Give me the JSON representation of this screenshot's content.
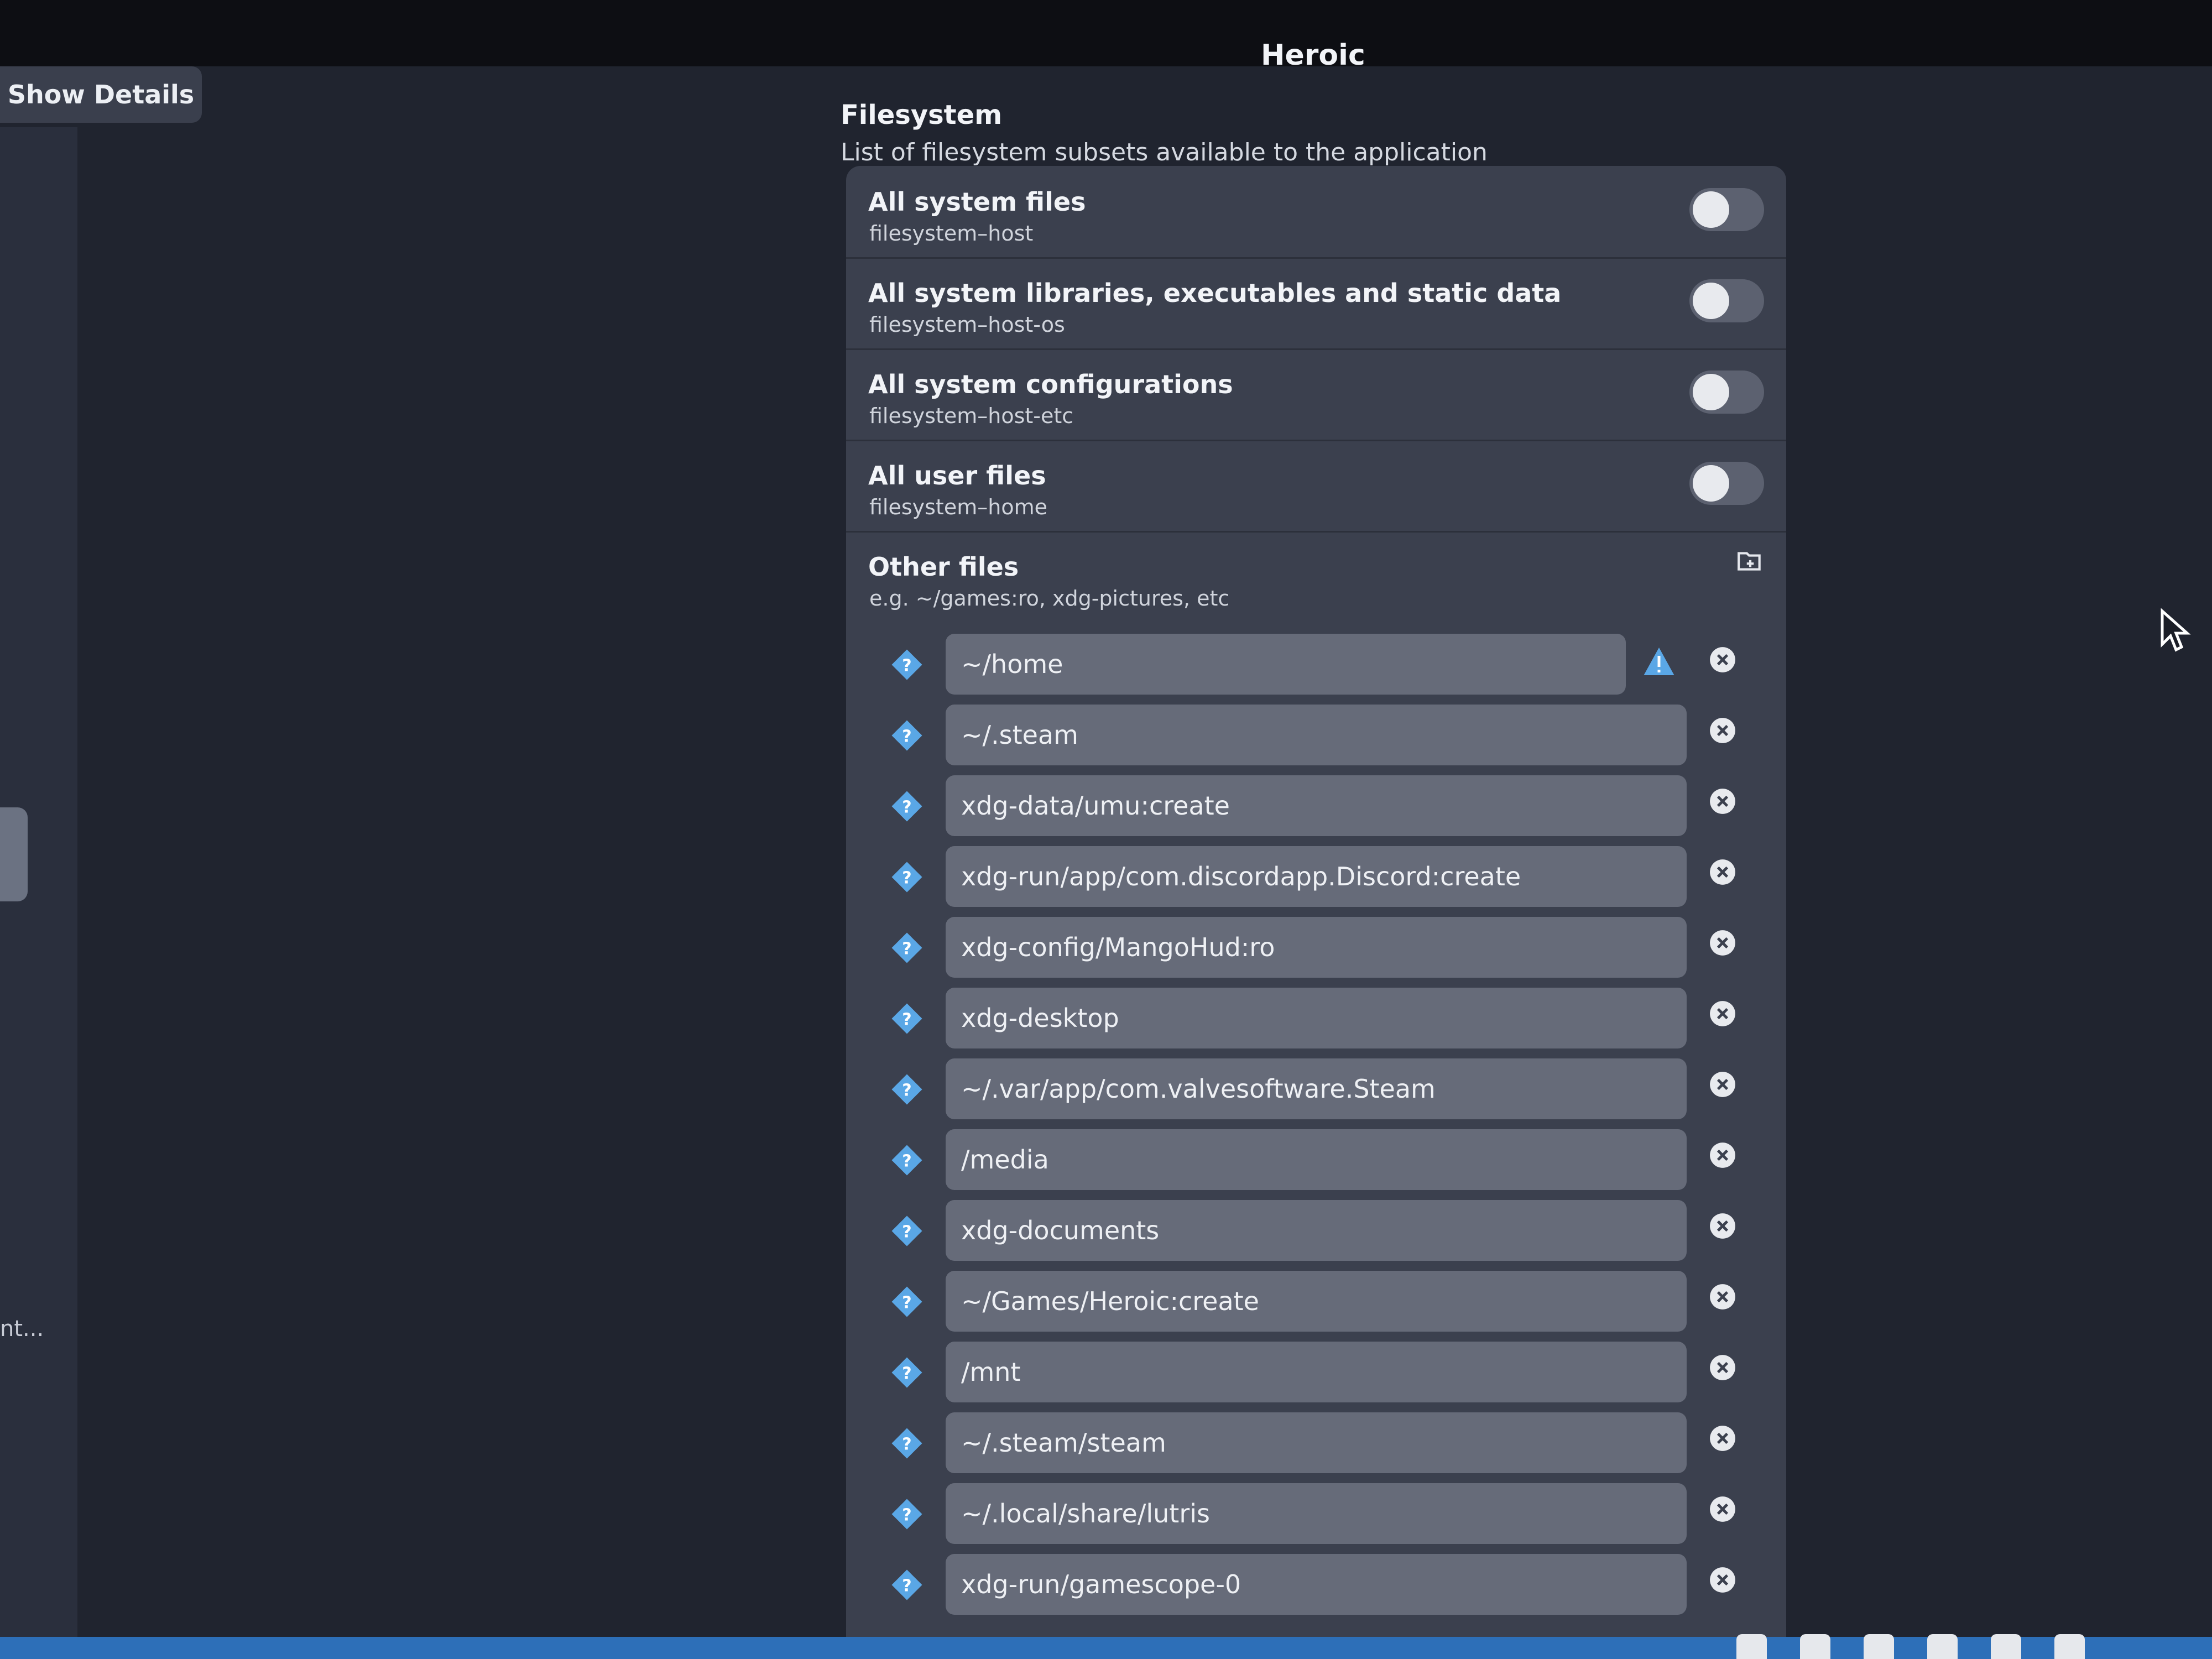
{
  "window": {
    "title": "Heroic"
  },
  "header": {
    "show_details_label": "Show Details"
  },
  "sidebar": {
    "truncated_label": "nt..."
  },
  "filesystem": {
    "title": "Filesystem",
    "subtitle": "List of filesystem subsets available to the application",
    "permissions": [
      {
        "title": "All system files",
        "subtitle": "filesystem–host",
        "enabled": false
      },
      {
        "title": "All system libraries, executables and static data",
        "subtitle": "filesystem–host-os",
        "enabled": false
      },
      {
        "title": "All system configurations",
        "subtitle": "filesystem–host-etc",
        "enabled": false
      },
      {
        "title": "All user files",
        "subtitle": "filesystem–home",
        "enabled": false
      }
    ],
    "other_files": {
      "title": "Other files",
      "subtitle": "e.g. ~/games:ro, xdg-pictures, etc",
      "entries": [
        {
          "value": "~/home",
          "warning": true
        },
        {
          "value": "~/.steam",
          "warning": false
        },
        {
          "value": "xdg-data/umu:create",
          "warning": false
        },
        {
          "value": "xdg-run/app/com.discordapp.Discord:create",
          "warning": false
        },
        {
          "value": "xdg-config/MangoHud:ro",
          "warning": false
        },
        {
          "value": "xdg-desktop",
          "warning": false
        },
        {
          "value": "~/.var/app/com.valvesoftware.Steam",
          "warning": false
        },
        {
          "value": "/media",
          "warning": false
        },
        {
          "value": "xdg-documents",
          "warning": false
        },
        {
          "value": "~/Games/Heroic:create",
          "warning": false
        },
        {
          "value": "/mnt",
          "warning": false
        },
        {
          "value": "~/.steam/steam",
          "warning": false
        },
        {
          "value": "~/.local/share/lutris",
          "warning": false
        },
        {
          "value": "xdg-run/gamescope-0",
          "warning": false
        }
      ]
    }
  },
  "icons": {
    "help": "help-diamond-icon",
    "remove": "remove-circle-icon",
    "warning": "warning-triangle-icon",
    "add_folder": "folder-add-icon"
  },
  "colors": {
    "background": "#20242f",
    "card": "#3b404e",
    "field": "#666b79",
    "accent": "#5aa7e6",
    "taskbar": "#2d6fb8"
  }
}
